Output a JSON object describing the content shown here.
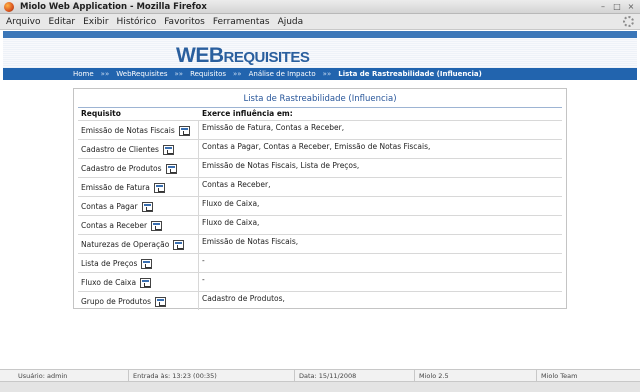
{
  "window": {
    "title": "Miolo Web Application - Mozilla Firefox",
    "minimize": "–",
    "maximize": "□",
    "close": "×"
  },
  "menubar": {
    "items": [
      {
        "label": "Arquivo"
      },
      {
        "label": "Editar"
      },
      {
        "label": "Exibir"
      },
      {
        "label": "Histórico"
      },
      {
        "label": "Favoritos"
      },
      {
        "label": "Ferramentas"
      },
      {
        "label": "Ajuda"
      }
    ]
  },
  "header": {
    "logo_prefix": "WEB",
    "logo_suffix": "REQUISITES",
    "brand_color": "#2264ae"
  },
  "breadcrumb": {
    "items": [
      "Home",
      "WebRequisites",
      "Requisitos",
      "Análise de Impacto"
    ],
    "separator": "»»",
    "current": "Lista de Rastreabilidade (Influencia)"
  },
  "panel": {
    "title": "Lista de Rastreabilidade (Influencia)",
    "col_requisito": "Requisito",
    "col_influencia": "Exerce influência em:",
    "rows": [
      {
        "requisito": "Emissão de Notas Fiscais",
        "influencia": "Emissão de Fatura, Contas a Receber,"
      },
      {
        "requisito": "Cadastro de Clientes",
        "influencia": "Contas a Pagar, Contas a Receber, Emissão de Notas Fiscais,"
      },
      {
        "requisito": "Cadastro de Produtos",
        "influencia": "Emissão de Notas Fiscais, Lista de Preços,"
      },
      {
        "requisito": "Emissão de Fatura",
        "influencia": "Contas a Receber,"
      },
      {
        "requisito": "Contas a Pagar",
        "influencia": "Fluxo de Caixa,"
      },
      {
        "requisito": "Contas a Receber",
        "influencia": "Fluxo de Caixa,"
      },
      {
        "requisito": "Naturezas de Operação",
        "influencia": "Emissão de Notas Fiscais,"
      },
      {
        "requisito": "Lista de Preços",
        "influencia": "-"
      },
      {
        "requisito": "Fluxo de Caixa",
        "influencia": "-"
      },
      {
        "requisito": "Grupo de Produtos",
        "influencia": "Cadastro de Produtos,"
      }
    ]
  },
  "statusbar": {
    "usuario": "Usuário: admin",
    "entrada": "Entrada às: 13:23 (00:35)",
    "data": "Data: 15/11/2008",
    "versao": "Miolo 2.5",
    "team": "Miolo Team"
  }
}
